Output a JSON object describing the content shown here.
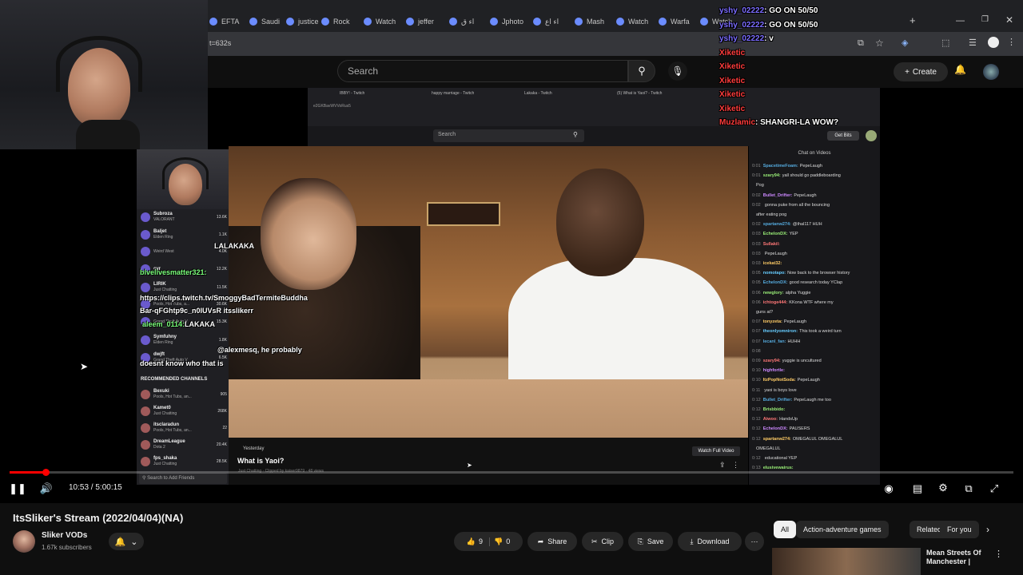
{
  "browser": {
    "tabs": [
      "EFTA",
      "Saudi",
      "justice",
      "Rock",
      "Watch",
      "jeffer",
      "ﺍﺀ ﻕ",
      "Jphoto",
      "ﺍﺀ ﺍﻉ",
      "Mash",
      "Watch",
      "Warfa",
      "Watch"
    ],
    "url": "t=632s"
  },
  "youtube_header": {
    "search_placeholder": "Search",
    "create_label": "Create"
  },
  "stream_chat_overlay": [
    {
      "user": "yshy_02222",
      "text": ": GO ON 50/50"
    },
    {
      "user": "yshy_02222",
      "text": ": GO ON 50/50"
    },
    {
      "user": "yshy_02222",
      "text": ": v"
    },
    {
      "user": "Xiketic",
      "text": ""
    },
    {
      "user": "Xiketic",
      "text": ""
    },
    {
      "user": "Xiketic",
      "text": ""
    },
    {
      "user": "Xiketic",
      "text": ""
    },
    {
      "user": "Xiketic",
      "text": ""
    },
    {
      "user": "Muzlamic",
      "text": ": SHANGRI-LA WOW?"
    }
  ],
  "inner_browser": {
    "tabs": [
      "IBBY! - Twitch",
      "happy marriage - Twitch",
      "Lakaka - Twitch",
      "(5) What is Yaoi? - Twitch"
    ],
    "url": "e2GKBavWVVoRus5",
    "search_placeholder": "Search",
    "get_bits": "Get Bits"
  },
  "twitch_sidebar": {
    "top_channels": [
      {
        "name": "Subroza",
        "game": "VALORANT",
        "count": "13.6K"
      },
      {
        "name": "Baljet",
        "game": "Elden Ring",
        "count": "1.1K"
      },
      {
        "name": "",
        "game": "Weird West",
        "count": "4.0K"
      },
      {
        "name": "cyr",
        "game": "",
        "count": "12.2K"
      },
      {
        "name": "LIRIK",
        "game": "Just Chatting",
        "count": "11.5K"
      },
      {
        "name": "",
        "game": "Pools, Hot Tubs, a...",
        "count": "30.6K"
      },
      {
        "name": "",
        "game": "Grand Theft Auto V",
        "count": "15.3K"
      },
      {
        "name": "Symfuhny",
        "game": "Elden Ring",
        "count": "1.8K"
      },
      {
        "name": "dwjft",
        "game": "Grand Theft Auto V",
        "count": "6.5K"
      }
    ],
    "recommended_title": "RECOMMENDED CHANNELS",
    "recommended": [
      {
        "name": "Bexuki",
        "game": "Pools, Hot Tubs, an...",
        "count": "905"
      },
      {
        "name": "Kamet0",
        "game": "Just Chatting",
        "count": "268K"
      },
      {
        "name": "itsclaradun",
        "game": "Pools, Hot Tubs, an...",
        "count": "22"
      },
      {
        "name": "DreamLeague",
        "game": "Dota 2",
        "count": "20.4K"
      },
      {
        "name": "fps_shaka",
        "game": "Just Chatting",
        "count": "28.5K"
      }
    ],
    "search_friends": "Search to Add Friends"
  },
  "overlay_messages": [
    {
      "user": "",
      "text": "LALAKAKA"
    },
    {
      "user": "blvelivesmatter321:",
      "text": ""
    },
    {
      "user": "",
      "text": "https://clips.twitch.tv/SmoggyBadTermiteBuddha"
    },
    {
      "user": "",
      "text": "Bar-qFGhtp9c_n0IUVsR itsslikerr"
    },
    {
      "user": "aleem_0114:",
      "text": "LAKAKA"
    },
    {
      "user": "",
      "text": "@alexmesq, he probably"
    },
    {
      "user": "",
      "text": "doesnt know who that is"
    }
  ],
  "twitch_chat": {
    "header": "Chat on Videos",
    "messages": [
      {
        "t": "0:01",
        "user": "SpacetimeFoam:",
        "text": "PepeLaugh"
      },
      {
        "t": "0:01",
        "user": "szary94:",
        "text": "yall should go paddleboarding"
      },
      {
        "t": "",
        "user": "",
        "text": "Pog"
      },
      {
        "t": "0:02",
        "user": "Bullet_Drifter:",
        "text": "PepeLaugh"
      },
      {
        "t": "0:02",
        "user": "",
        "text": "gonna puke from all the bouncing"
      },
      {
        "t": "",
        "user": "",
        "text": "after eating pog"
      },
      {
        "t": "0:02",
        "user": "spartanw274:",
        "text": "@thal117 HUH"
      },
      {
        "t": "0:03",
        "user": "EchelonDX:",
        "text": "YEP"
      },
      {
        "t": "0:03",
        "user": "Sullakil:",
        "text": ""
      },
      {
        "t": "0:03",
        "user": "",
        "text": "PepeLaugh"
      },
      {
        "t": "0:03",
        "user": "icekat32:",
        "text": ""
      },
      {
        "t": "0:05",
        "user": "nomotapo:",
        "text": "Now back to the browser history"
      },
      {
        "t": "0:05",
        "user": "EchelonDX:",
        "text": "good research today YClap"
      },
      {
        "t": "0:06",
        "user": "newglory:",
        "text": "alpha Yuggie"
      },
      {
        "t": "0:06",
        "user": "ichtoge444:",
        "text": "KKona WTF where my"
      },
      {
        "t": "",
        "user": "",
        "text": "guns at?"
      },
      {
        "t": "0:07",
        "user": "tonyzeta:",
        "text": "PepeLaugh"
      },
      {
        "t": "0:07",
        "user": "theonlyomniron:",
        "text": "This took a weird turn"
      },
      {
        "t": "0:07",
        "user": "lecanl_fan:",
        "text": "HUHH"
      },
      {
        "t": "0:08",
        "user": "",
        "text": ""
      },
      {
        "t": "0:09",
        "user": "szary94:",
        "text": "yuggie is uncultured"
      },
      {
        "t": "0:10",
        "user": "highfortle:",
        "text": ""
      },
      {
        "t": "0:10",
        "user": "ItzPopNotSoda:",
        "text": "PepeLaugh"
      },
      {
        "t": "0:11",
        "user": "",
        "text": "yaoi is boys love"
      },
      {
        "t": "0:12",
        "user": "Bullet_Drifter:",
        "text": "PepeLaugh me too"
      },
      {
        "t": "0:12",
        "user": "Brisbbido:",
        "text": ""
      },
      {
        "t": "0:12",
        "user": "Aiwoo:",
        "text": "HandsUp"
      },
      {
        "t": "0:12",
        "user": "EchelonDX:",
        "text": "PAUSERS"
      },
      {
        "t": "0:12",
        "user": "spartanw274:",
        "text": "OMEGALUL OMEGALUL"
      },
      {
        "t": "",
        "user": "",
        "text": "OMEGALUL"
      },
      {
        "t": "0:12",
        "user": "",
        "text": "educational YEP"
      },
      {
        "t": "0:13",
        "user": "elusivewairus:",
        "text": ""
      }
    ]
  },
  "clip": {
    "date": "Yesterday",
    "title": "What is Yaoi?",
    "subtitle": "Just Chatting · Clipped by kaiser9879 · 48 views",
    "watch_full": "Watch Full Video"
  },
  "player": {
    "time": "10:53 / 5:00:15",
    "progress_fraction": 0.036
  },
  "video": {
    "title": "ItsSliker's Stream (2022/04/04)(NA)",
    "channel": "Sliker VODs",
    "subscribers": "1.67k subscribers",
    "likes": "9",
    "dislikes": "0",
    "share": "Share",
    "clip": "Clip",
    "save": "Save",
    "download": "Download"
  },
  "chips": [
    "All",
    "Action-adventure games",
    "Related",
    "For you"
  ],
  "recommendation": {
    "title": "Mean Streets Of Manchester |"
  }
}
